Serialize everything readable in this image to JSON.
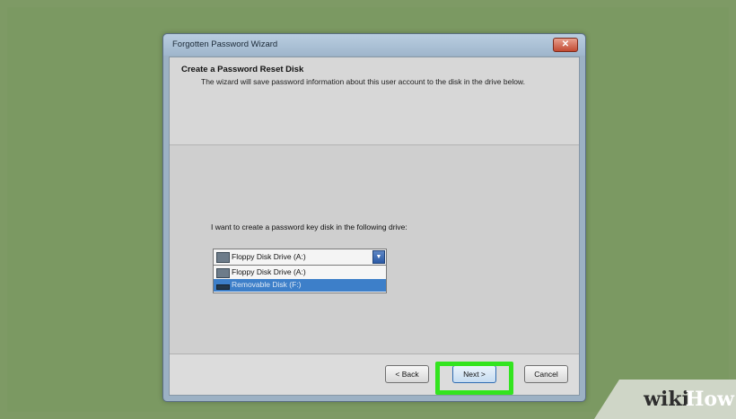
{
  "window": {
    "title": "Forgotten Password Wizard",
    "close_glyph": "✕"
  },
  "header": {
    "title": "Create a Password Reset Disk",
    "description": "The wizard will save password information about this user account to the disk in the drive below."
  },
  "body": {
    "prompt": "I want to create a password key disk in the following drive:",
    "drive_select": {
      "selected": "Floppy Disk Drive (A:)",
      "options": [
        "Floppy Disk Drive (A:)",
        "Removable Disk (F:)"
      ],
      "highlighted_index": 1
    }
  },
  "buttons": {
    "back": "< Back",
    "next": "Next >",
    "cancel": "Cancel"
  },
  "watermark": {
    "wiki": "wiki",
    "how": "How"
  },
  "colors": {
    "highlight": "#33e41f",
    "selection": "#3d7fc9",
    "background": "#7e9a65"
  },
  "icons": {
    "drive": "floppy-drive-icon",
    "removable": "removable-disk-icon",
    "dropdown": "chevron-down-icon",
    "close": "close-icon"
  }
}
